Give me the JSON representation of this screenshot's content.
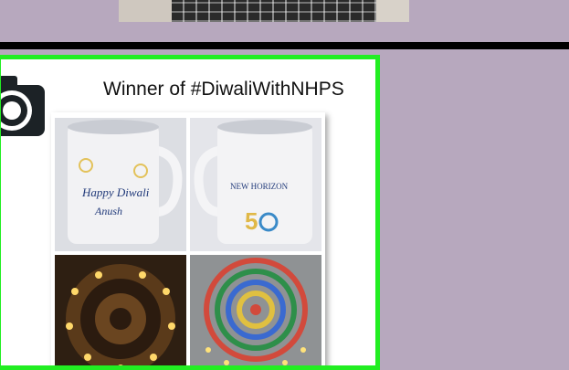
{
  "post": {
    "title": "Winner of #DiwaliWithNHPS",
    "mug1_text": [
      "Happy Diwali",
      "Anush"
    ],
    "mug2_text": "NEW HORIZON"
  },
  "colors": {
    "border": "#22ee22",
    "background": "#b7a8be",
    "divider": "#000000"
  },
  "icons": [
    "camera-icon"
  ]
}
